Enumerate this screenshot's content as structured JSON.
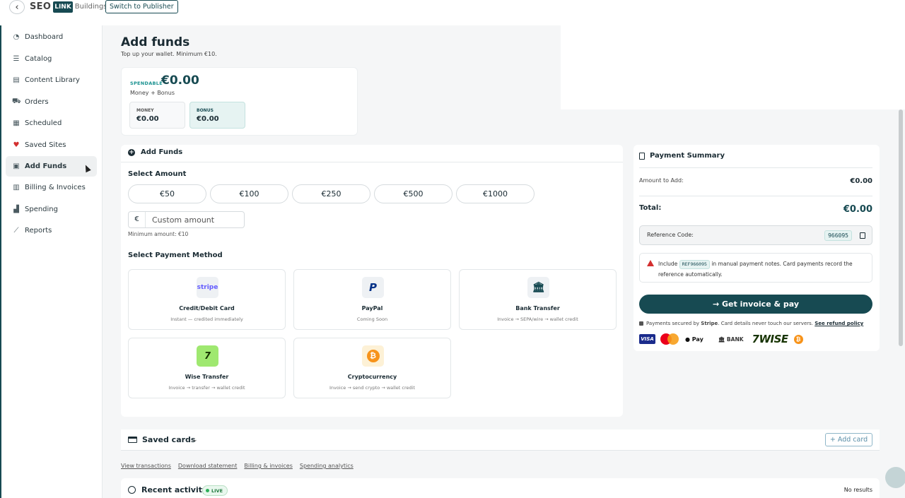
{
  "topbar": {
    "back_icon": "chevron-left-icon",
    "logo": {
      "seo": "SEO",
      "link": "LINK",
      "buildings": "Buildings"
    },
    "switch_label": "Switch to Publisher"
  },
  "sidebar": {
    "items": [
      {
        "label": "Dashboard",
        "icon": "dashboard-icon"
      },
      {
        "label": "Catalog",
        "icon": "list-icon"
      },
      {
        "label": "Content Library",
        "icon": "document-icon"
      },
      {
        "label": "Orders",
        "icon": "cart-icon"
      },
      {
        "label": "Scheduled",
        "icon": "calendar-icon"
      },
      {
        "label": "Saved Sites",
        "icon": "heart-icon"
      },
      {
        "label": "Add Funds",
        "icon": "wallet-icon",
        "active": true
      },
      {
        "label": "Billing & Invoices",
        "icon": "invoice-icon"
      },
      {
        "label": "Spending",
        "icon": "bar-chart-icon"
      },
      {
        "label": "Reports",
        "icon": "line-chart-icon"
      }
    ]
  },
  "header": {
    "title": "Add funds",
    "subtitle": "Top up your wallet. Minimum €10."
  },
  "wallet": {
    "spendable_label": "SPENDABLE",
    "spendable_value": "€0.00",
    "money_bonus_label": "Money + Bonus",
    "money_label": "MONEY",
    "money_value": "€0.00",
    "bonus_label": "BONUS",
    "bonus_value": "€0.00"
  },
  "add_funds": {
    "title": "Add Funds",
    "select_amount_label": "Select Amount",
    "amounts": [
      "€50",
      "€100",
      "€250",
      "€500",
      "€1000"
    ],
    "currency_symbol": "€",
    "custom_placeholder": "Custom amount",
    "min_note": "Minimum amount: €10",
    "select_method_label": "Select Payment Method",
    "methods": [
      {
        "name": "Credit/Debit Card",
        "desc": "Instant — credited immediately",
        "icon_text": "stripe"
      },
      {
        "name": "PayPal",
        "desc": "Coming Soon",
        "icon_text": "P"
      },
      {
        "name": "Bank Transfer",
        "desc": "Invoice → SEPA/wire → wallet credit",
        "icon_text": "🏛"
      },
      {
        "name": "Wise Transfer",
        "desc": "Invoice → transfer → wallet credit",
        "icon_text": "7"
      },
      {
        "name": "Cryptocurrency",
        "desc": "Invoice → send crypto → wallet credit",
        "icon_text": "₿"
      }
    ]
  },
  "summary": {
    "title": "Payment Summary",
    "amount_label": "Amount to Add:",
    "amount_value": "€0.00",
    "total_label": "Total:",
    "total_value": "€0.00",
    "ref_label": "Reference Code:",
    "ref_code": "966095",
    "note_prefix": "Include",
    "note_ref": "REF966095",
    "note_suffix": "in manual payment notes. Card payments record the reference automatically.",
    "pay_button": "→  Get invoice & pay",
    "secure_prefix": "Payments secured by",
    "secure_brand": "Stripe",
    "secure_suffix": ". Card details never touch our servers.",
    "refund_link": "See refund policy",
    "brands": {
      "visa": "VISA",
      "apple_pay": " Pay",
      "bank": "🏛 BANK",
      "wise": "7WISE",
      "btc": "₿"
    }
  },
  "saved_cards": {
    "title": "Saved cards",
    "chevron": "⌄",
    "add_card": "+ Add card"
  },
  "quick_links": [
    "View transactions",
    "Download statement",
    "Billing & invoices",
    "Spending analytics"
  ],
  "recent_activity": {
    "title": "Recent activity",
    "live_badge": "LIVE",
    "empty_text": "No results"
  },
  "colors": {
    "brand": "#174a52",
    "accent_teal": "#17908f",
    "danger": "#d32f2f"
  }
}
